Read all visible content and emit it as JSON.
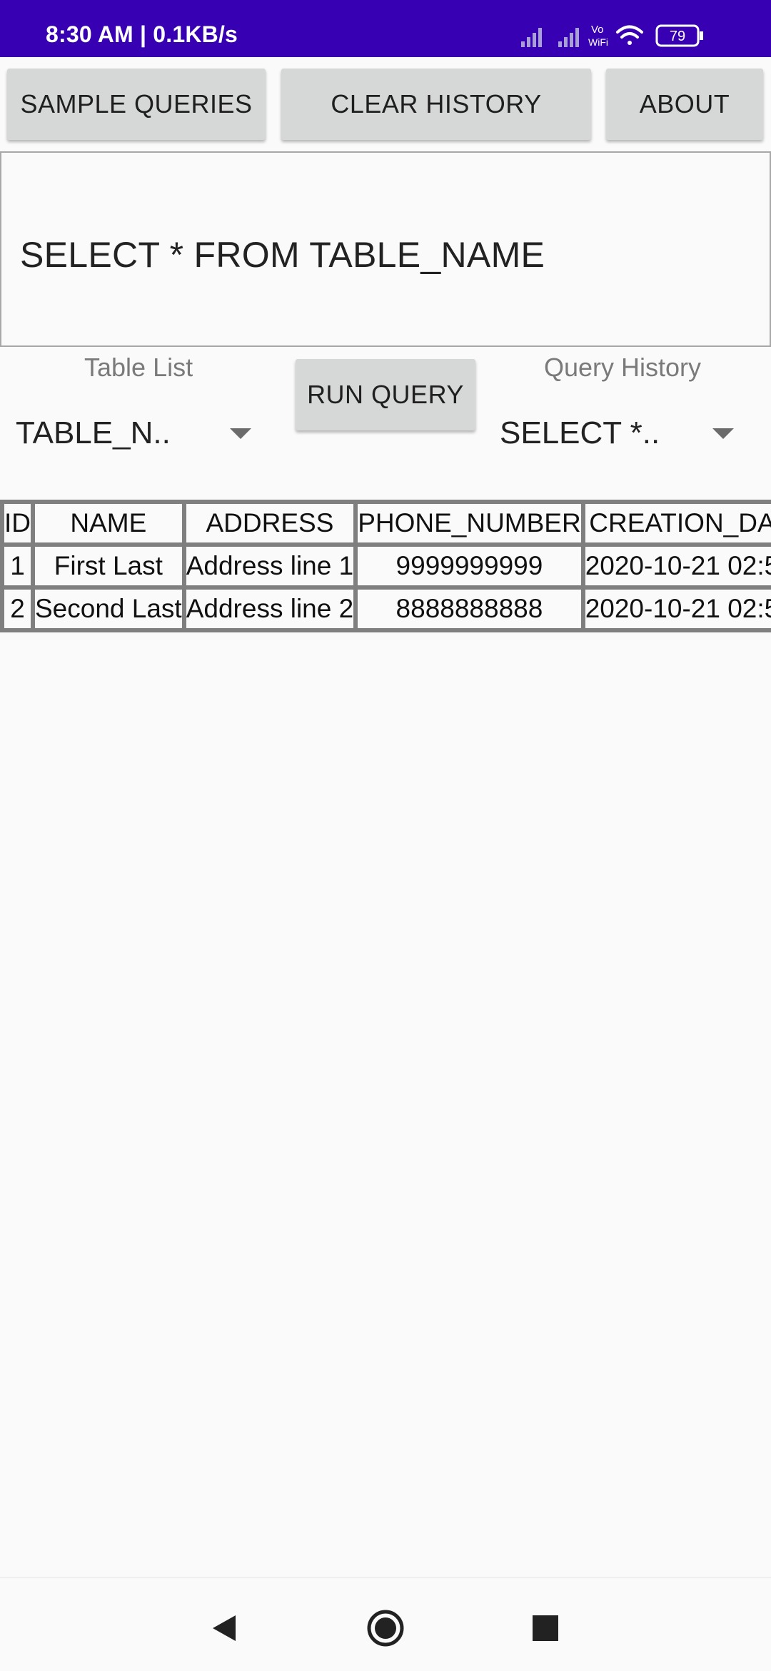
{
  "status_bar": {
    "time": "8:30 AM | 0.1KB/s",
    "battery": "79",
    "vowifi_top": "Vo",
    "vowifi_bottom": "WiFi",
    "color": "#3700b3"
  },
  "toolbar": {
    "sample_queries": "SAMPLE QUERIES",
    "clear_history": "CLEAR HISTORY",
    "about": "ABOUT"
  },
  "query_input": {
    "value": "SELECT * FROM TABLE_NAME"
  },
  "table_list": {
    "label": "Table List",
    "selected": "TABLE_N.."
  },
  "run_query": {
    "label": "RUN QUERY"
  },
  "query_history": {
    "label": "Query History",
    "selected": "SELECT *.."
  },
  "results": {
    "columns": [
      "ID",
      "NAME",
      "ADDRESS",
      "PHONE_NUMBER",
      "CREATION_DA"
    ],
    "rows": [
      [
        "1",
        "First Last",
        "Address line 1",
        "9999999999",
        "2020-10-21 02:5"
      ],
      [
        "2",
        "Second Last",
        "Address line 2",
        "8888888888",
        "2020-10-21 02:5"
      ]
    ]
  },
  "nav_bar": {
    "icons": [
      "back-icon",
      "home-icon",
      "recents-icon"
    ]
  }
}
